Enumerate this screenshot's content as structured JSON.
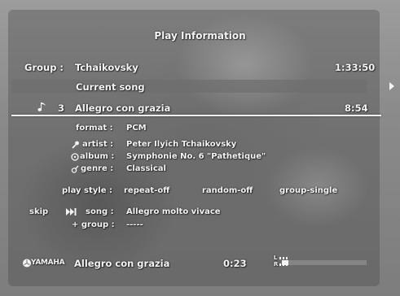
{
  "title": "Play Information",
  "group": {
    "label": "Group :",
    "name": "Tchaikovsky",
    "time": "1:33:50"
  },
  "current": {
    "label": "Current song"
  },
  "track": {
    "number": "3",
    "name": "Allegro con grazia",
    "time": "8:54"
  },
  "info": {
    "format_label": "format :",
    "format_value": "PCM",
    "artist_label": "artist :",
    "artist_value": "Peter Ilyich Tchaikovsky",
    "album_label": "album :",
    "album_value": "Symphonie No. 6 \"Pathetique\"",
    "genre_label": "genre :",
    "genre_value": "Classical"
  },
  "playstyle": {
    "label": "play style :",
    "repeat": "repeat-off",
    "random": "random-off",
    "group": "group-single"
  },
  "skip": {
    "label": "skip",
    "song_label": "song :",
    "song_value": "Allegro molto vivace",
    "group_label": "+ group :",
    "group_value": "-----"
  },
  "footer": {
    "brand": "YAMAHA",
    "song": "Allegro con grazia",
    "elapsed": "0:23",
    "levels": [
      "L",
      "R"
    ],
    "progress_fraction": 0.08
  },
  "icons": {
    "note": "music-note-icon",
    "artist": "microphone-icon",
    "album": "disc-icon",
    "genre": "genre-icon",
    "skip": "skip-forward-icon",
    "brand": "yamaha-logo-icon",
    "next": "play-arrow-icon"
  }
}
